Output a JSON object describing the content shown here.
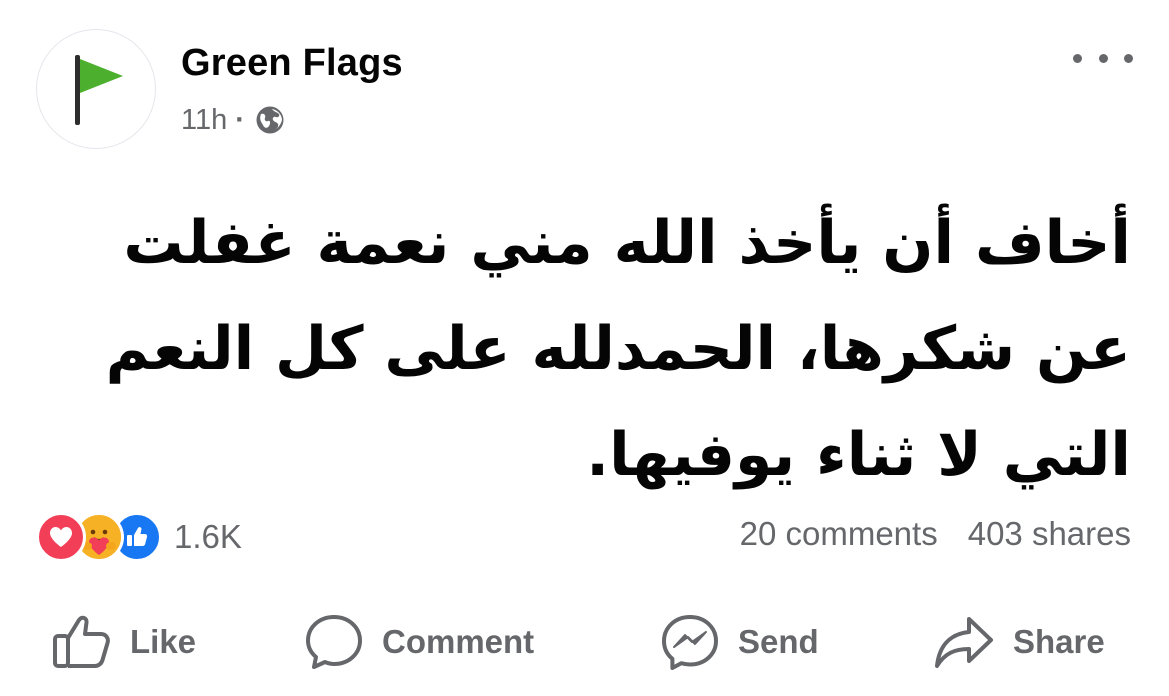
{
  "post": {
    "page_name": "Green Flags",
    "time": "11h",
    "separator": "·",
    "audience_icon": "globe-icon",
    "text": "أخاف أن يأخذ الله مني نعمة غفلت عن شكرها، الحمدلله على كل النعم التي لا ثناء يوفيها."
  },
  "avatar": {
    "icon": "green-flag-icon",
    "flag_color": "#4caf2e"
  },
  "engagement": {
    "reactions": [
      "love",
      "care",
      "like"
    ],
    "reaction_count": "1.6K",
    "comments": "20 comments",
    "shares": "403 shares"
  },
  "actions": {
    "like": "Like",
    "comment": "Comment",
    "send": "Send",
    "share": "Share"
  },
  "colors": {
    "text_primary": "#050505",
    "text_secondary": "#65676b",
    "love": "#f33e58",
    "care": "#f7b125",
    "like": "#1877f2"
  }
}
